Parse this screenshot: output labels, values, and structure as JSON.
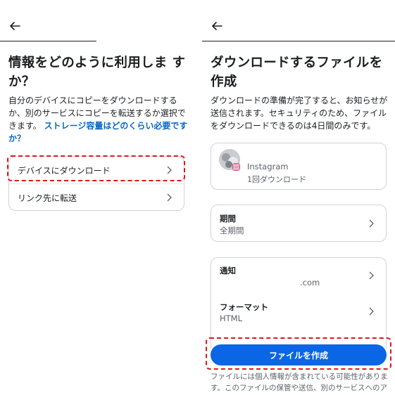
{
  "left": {
    "title_line1": "情報をどのように利用しま す",
    "title_line2": "か？",
    "desc_line1": "自分のデバイスにコピーをダウンロードする",
    "desc_line2": "か、別のサービスにコピーを転送するか選択で",
    "desc_line3_plain": "きます。",
    "desc_link_a": "ストレージ容量はどのくらい必要です",
    "desc_link_b": "か？",
    "options": [
      {
        "label": "デバイスにダウンロード"
      },
      {
        "label": "リンク先に転送"
      }
    ]
  },
  "right": {
    "title_line1": "ダウンロードするファイルを",
    "title_line2": "作成",
    "desc_line1": "ダウンロードの準備が完了すると、お知らせが",
    "desc_line2": "送信されます。セキュリティのため、ファイル",
    "desc_line3": "をダウンロードできるのは4日間のみです。",
    "account": {
      "name": "Instagram",
      "sub": "1回ダウンロード",
      "badge_icon": "instagram-icon"
    },
    "period": {
      "label": "期間",
      "value": "全期間"
    },
    "notify": {
      "label": "通知",
      "value": ".com"
    },
    "format": {
      "label": "フォーマット",
      "value": "HTML"
    },
    "create_button": "ファイルを作成",
    "footnote_line1": "ファイルには個人情報が含まれている可能性がありま",
    "footnote_line2": "す。このファイルの保管や送信、別のサービスへのア"
  },
  "colors": {
    "accent": "#0a66e4",
    "link": "#0a66c2",
    "highlight": "#e0161c"
  },
  "icons": {
    "back": "arrow-left-icon",
    "chevron": "chevron-right-icon"
  }
}
